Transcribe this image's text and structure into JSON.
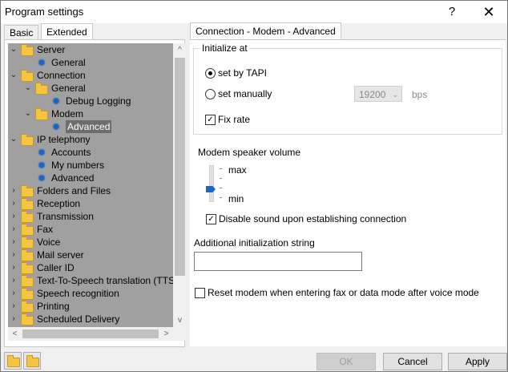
{
  "window": {
    "title": "Program settings",
    "help_glyph": "?",
    "close_glyph": "✕"
  },
  "tabs": [
    {
      "label": "Basic"
    },
    {
      "label": "Extended"
    }
  ],
  "tree": {
    "items": [
      {
        "label": "Server",
        "expand": "⌄",
        "icon": "folder-icon"
      },
      {
        "label": "General",
        "icon": "gear-icon"
      },
      {
        "label": "Connection",
        "expand": "⌄",
        "icon": "folder-icon"
      },
      {
        "label": "General",
        "expand": "⌄",
        "icon": "folder-icon"
      },
      {
        "label": "Debug Logging",
        "icon": "gear-icon"
      },
      {
        "label": "Modem",
        "expand": "⌄",
        "icon": "folder-icon"
      },
      {
        "label": "Advanced",
        "icon": "gear-icon"
      },
      {
        "label": "IP telephony",
        "expand": "⌄",
        "icon": "folder-icon"
      },
      {
        "label": "Accounts",
        "icon": "gear-icon"
      },
      {
        "label": "My numbers",
        "icon": "gear-icon"
      },
      {
        "label": "Advanced",
        "icon": "gear-icon"
      },
      {
        "label": "Folders and Files",
        "expand": "›",
        "icon": "folder-icon"
      },
      {
        "label": "Reception",
        "expand": "›",
        "icon": "folder-icon"
      },
      {
        "label": "Transmission",
        "expand": "›",
        "icon": "folder-icon"
      },
      {
        "label": "Fax",
        "expand": "›",
        "icon": "folder-icon"
      },
      {
        "label": "Voice",
        "expand": "›",
        "icon": "folder-icon"
      },
      {
        "label": "Mail server",
        "expand": "›",
        "icon": "folder-icon"
      },
      {
        "label": "Caller ID",
        "expand": "›",
        "icon": "folder-icon"
      },
      {
        "label": "Text-To-Speech translation (TTS)",
        "expand": "›",
        "icon": "folder-icon"
      },
      {
        "label": "Speech recognition",
        "expand": "›",
        "icon": "folder-icon"
      },
      {
        "label": "Printing",
        "expand": "›",
        "icon": "folder-icon"
      },
      {
        "label": "Scheduled Delivery",
        "expand": "›",
        "icon": "folder-icon"
      }
    ],
    "selected": "Advanced"
  },
  "scroll": {
    "up": "^",
    "down": "v",
    "left": "<",
    "right": ">"
  },
  "content": {
    "tab_label": "Connection - Modem - Advanced",
    "initialize_group": "Initialize at",
    "radio_tapi": "set by TAPI",
    "radio_manual": "set manually",
    "speed_value": "19200",
    "speed_unit": "bps",
    "fix_rate": "Fix rate",
    "volume_label": "Modem speaker volume",
    "volume_max": "max",
    "volume_min": "min",
    "volume_level": 0.25,
    "disable_sound": "Disable sound upon establishing connection",
    "init_string_label": "Additional initialization string",
    "init_string_value": "",
    "reset_modem": "Reset modem when entering fax or data mode after voice mode"
  },
  "buttons": {
    "ok": "OK",
    "cancel": "Cancel",
    "apply": "Apply"
  }
}
